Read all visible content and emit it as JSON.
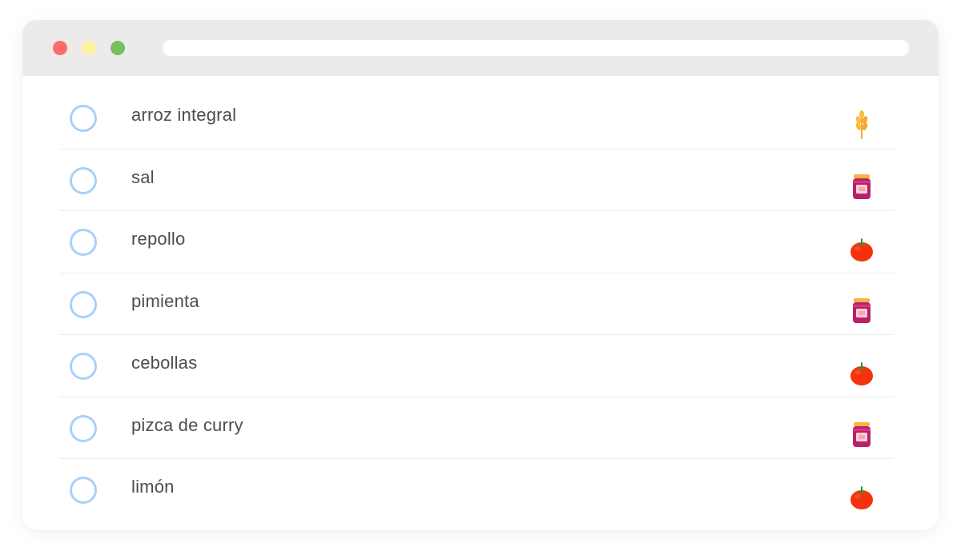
{
  "window": {
    "controls": [
      {
        "name": "close",
        "color": "#fe6b6c"
      },
      {
        "name": "minimize",
        "color": "#fdf2a6"
      },
      {
        "name": "zoom",
        "color": "#77c05a"
      }
    ]
  },
  "items": [
    {
      "label": "arroz integral",
      "icon": "wheat-icon",
      "checked": false
    },
    {
      "label": "sal",
      "icon": "jar-icon",
      "checked": false
    },
    {
      "label": "repollo",
      "icon": "tomato-icon",
      "checked": false
    },
    {
      "label": "pimienta",
      "icon": "jar-icon",
      "checked": false
    },
    {
      "label": "cebollas",
      "icon": "tomato-icon",
      "checked": false
    },
    {
      "label": "pizca de curry",
      "icon": "jar-icon",
      "checked": false
    },
    {
      "label": "limón",
      "icon": "tomato-icon",
      "checked": false
    }
  ],
  "colors": {
    "checkbox_ring": "#a9d0fb",
    "text": "#4d4d4d",
    "titlebar": "#ebebeb"
  }
}
